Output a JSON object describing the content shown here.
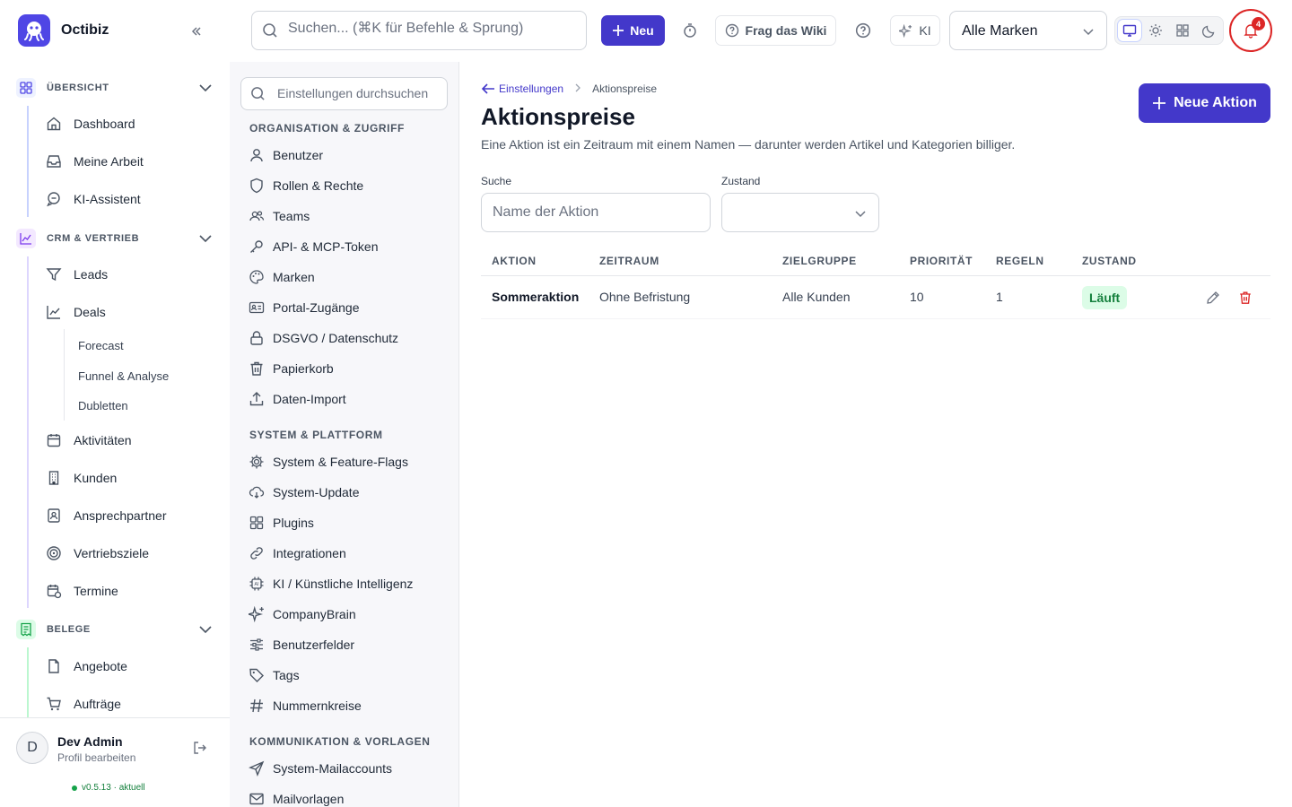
{
  "app": {
    "name": "Octibiz"
  },
  "topbar": {
    "search_placeholder": "Suchen... (⌘K für Befehle & Sprung)",
    "new_label": "Neu",
    "wiki_label": "Frag das Wiki",
    "ki_label": "KI",
    "brand_selected": "Alle Marken",
    "notification_count": "4"
  },
  "sidebar": {
    "sections": [
      {
        "label": "ÜBERSICHT",
        "items": [
          "Dashboard",
          "Meine Arbeit",
          "KI-Assistent"
        ]
      },
      {
        "label": "CRM & VERTRIEB",
        "items": [
          "Leads",
          "Deals",
          "Aktivitäten",
          "Kunden",
          "Ansprechpartner",
          "Vertriebsziele",
          "Termine"
        ],
        "deals_sub": [
          "Forecast",
          "Funnel & Analyse",
          "Dubletten"
        ]
      },
      {
        "label": "BELEGE",
        "items": [
          "Angebote",
          "Aufträge"
        ]
      }
    ],
    "user": {
      "initial": "D",
      "name": "Dev Admin",
      "profile": "Profil bearbeiten"
    },
    "version": "v0.5.13 · aktuell"
  },
  "settings": {
    "search_placeholder": "Einstellungen durchsuchen",
    "groups": [
      {
        "label": "ORGANISATION & ZUGRIFF",
        "items": [
          "Benutzer",
          "Rollen & Rechte",
          "Teams",
          "API- & MCP-Token",
          "Marken",
          "Portal-Zugänge",
          "DSGVO / Datenschutz",
          "Papierkorb",
          "Daten-Import"
        ]
      },
      {
        "label": "SYSTEM & PLATTFORM",
        "items": [
          "System & Feature-Flags",
          "System-Update",
          "Plugins",
          "Integrationen",
          "KI / Künstliche Intelligenz",
          "CompanyBrain",
          "Benutzerfelder",
          "Tags",
          "Nummernkreise"
        ]
      },
      {
        "label": "KOMMUNIKATION & VORLAGEN",
        "items": [
          "System-Mailaccounts",
          "Mailvorlagen"
        ]
      }
    ]
  },
  "main": {
    "breadcrumb_back": "Einstellungen",
    "breadcrumb_current": "Aktionspreise",
    "title": "Aktionspreise",
    "description": "Eine Aktion ist ein Zeitraum mit einem Namen — darunter werden Artikel und Kategorien billiger.",
    "add_label": "Neue Aktion",
    "filter_search_label": "Suche",
    "filter_search_placeholder": "Name der Aktion",
    "filter_state_label": "Zustand",
    "table": {
      "columns": [
        "AKTION",
        "ZEITRAUM",
        "ZIELGRUPPE",
        "PRIORITÄT",
        "REGELN",
        "ZUSTAND"
      ],
      "rows": [
        {
          "name": "Sommeraktion",
          "period": "Ohne Befristung",
          "audience": "Alle Kunden",
          "priority": "10",
          "rules": "1",
          "status": "Läuft"
        }
      ]
    }
  },
  "colors": {
    "accent": "#4338ca",
    "success": "#15803d",
    "danger": "#dc2626"
  }
}
